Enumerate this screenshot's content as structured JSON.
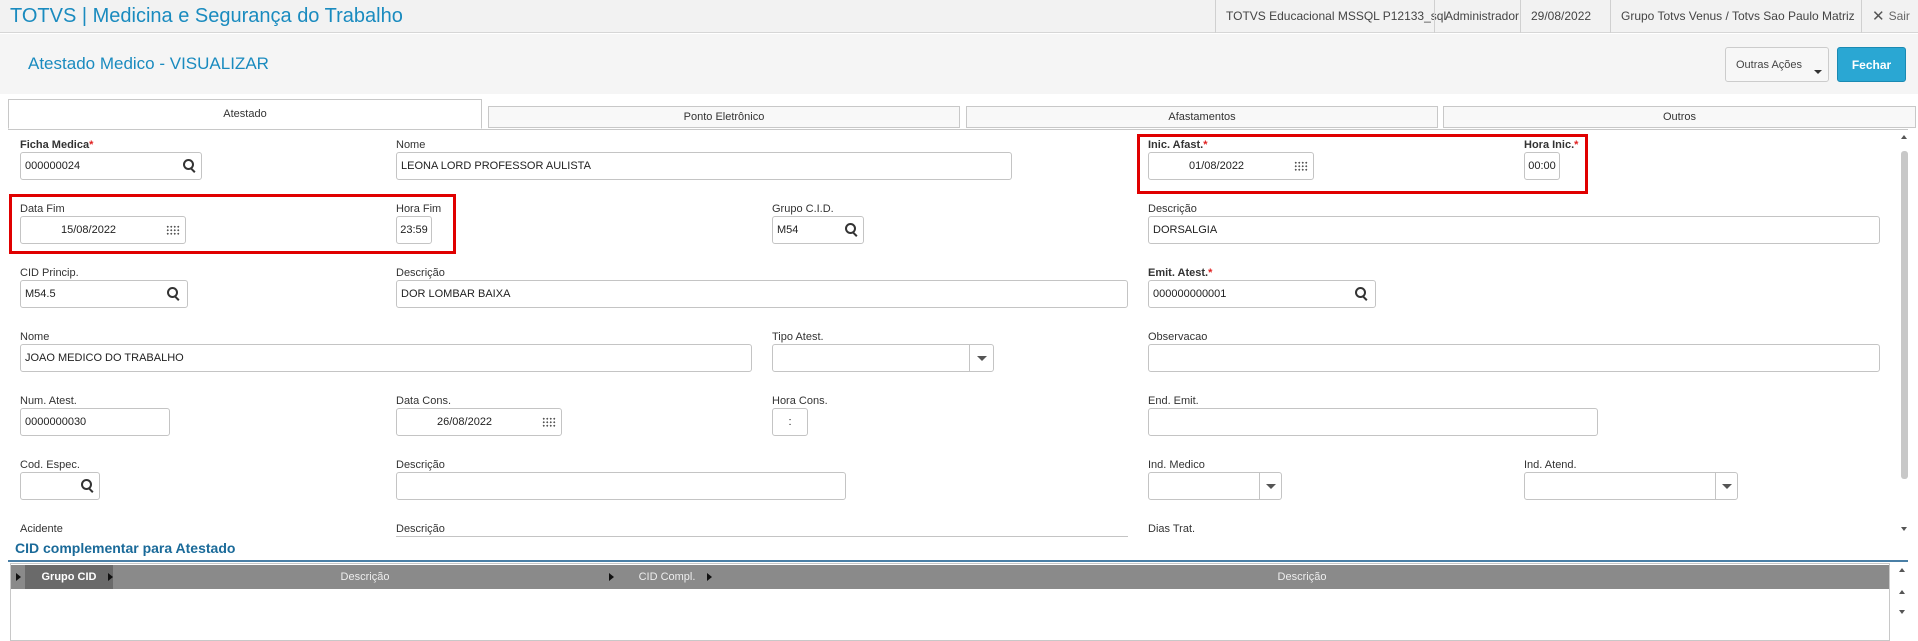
{
  "app": {
    "title": "TOTVS | Medicina e Segurança do Trabalho",
    "environment": "TOTVS Educacional MSSQL P12133_sql",
    "user": "Administrador",
    "date": "29/08/2022",
    "company": "Grupo Totvs Venus / Totvs Sao Paulo Matriz",
    "exit_label": "Sair"
  },
  "header": {
    "title": "Atestado Medico - VISUALIZAR",
    "other_actions_label": "Outras Ações",
    "close_label": "Fechar"
  },
  "tabs": [
    {
      "label": "Atestado",
      "active": true
    },
    {
      "label": "Ponto Eletrônico",
      "active": false
    },
    {
      "label": "Afastamentos",
      "active": false
    },
    {
      "label": "Outros",
      "active": false
    }
  ],
  "form": {
    "ficha_medica": {
      "label": "Ficha Medica",
      "value": "000000024"
    },
    "nome": {
      "label": "Nome",
      "value": "LEONA LORD PROFESSOR AULISTA"
    },
    "inic_afast": {
      "label": "Inic. Afast.",
      "value": "01/08/2022"
    },
    "hora_inic": {
      "label": "Hora Inic.",
      "value": "00:00"
    },
    "data_fim": {
      "label": "Data Fim",
      "value": "15/08/2022"
    },
    "hora_fim": {
      "label": "Hora Fim",
      "value": "23:59"
    },
    "grupo_cid": {
      "label": "Grupo C.I.D.",
      "value": "M54"
    },
    "descricao_grupo": {
      "label": "Descrição",
      "value": "DORSALGIA"
    },
    "cid_princip": {
      "label": "CID Princip.",
      "value": "M54.5"
    },
    "descricao_cid": {
      "label": "Descrição",
      "value": "DOR LOMBAR BAIXA"
    },
    "emit_atest": {
      "label": "Emit. Atest.",
      "value": "000000000001"
    },
    "nome_medico": {
      "label": "Nome",
      "value": "JOAO MEDICO DO TRABALHO"
    },
    "tipo_atest": {
      "label": "Tipo Atest.",
      "value": ""
    },
    "observacao": {
      "label": "Observacao",
      "value": ""
    },
    "num_atest": {
      "label": "Num. Atest.",
      "value": "0000000030"
    },
    "data_cons": {
      "label": "Data Cons.",
      "value": "26/08/2022"
    },
    "hora_cons": {
      "label": "Hora Cons.",
      "value": ":"
    },
    "end_emit": {
      "label": "End. Emit.",
      "value": ""
    },
    "cod_espec": {
      "label": "Cod. Espec.",
      "value": ""
    },
    "descricao_espec": {
      "label": "Descrição",
      "value": ""
    },
    "ind_medico": {
      "label": "Ind. Medico",
      "value": ""
    },
    "ind_atend": {
      "label": "Ind. Atend.",
      "value": ""
    },
    "acidente": {
      "label": "Acidente"
    },
    "descricao_acidente": {
      "label": "Descrição"
    },
    "dias_trat": {
      "label": "Dias Trat."
    }
  },
  "cid_section": {
    "title": "CID complementar para Atestado",
    "columns": [
      "Grupo CID",
      "Descrição",
      "CID Compl.",
      "Descrição"
    ]
  },
  "colors": {
    "accent": "#1a8bbf",
    "close_button": "#2aa7d3",
    "highlight_box": "#e00000",
    "required_star": "#e02020"
  }
}
